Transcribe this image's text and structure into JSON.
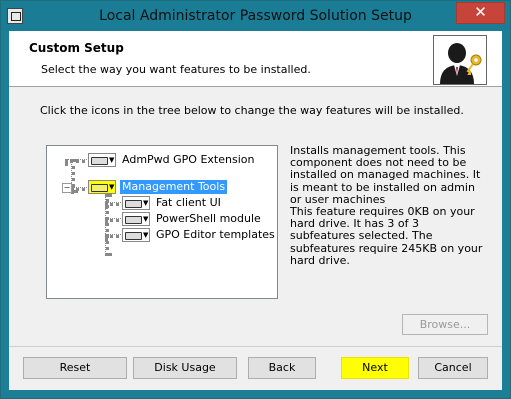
{
  "window": {
    "title": "Local Administrator Password Solution Setup",
    "close_glyph": "✕"
  },
  "header": {
    "title": "Custom Setup",
    "subtitle": "Select the way you want features to be installed."
  },
  "instruction": "Click the icons in the tree below to change the way features will be installed.",
  "tree": {
    "items": [
      {
        "label": "AdmPwd GPO Extension",
        "selected": false,
        "level": 0
      },
      {
        "label": "Management Tools",
        "selected": true,
        "level": 0,
        "expanded": true
      },
      {
        "label": "Fat client UI",
        "selected": false,
        "level": 1
      },
      {
        "label": "PowerShell module",
        "selected": false,
        "level": 1
      },
      {
        "label": "GPO Editor templates",
        "selected": false,
        "level": 1
      }
    ],
    "expander_glyph": "−",
    "arrow_glyph": "▼"
  },
  "description": {
    "text": "Installs management tools. This component does not need to be installed on managed machines. It is meant to be installed on admin or user machines\nThis feature requires 0KB on your hard drive. It has 3 of 3 subfeatures selected. The subfeatures require 245KB on your hard drive."
  },
  "buttons": {
    "browse": "Browse...",
    "reset": "Reset",
    "disk_usage": "Disk Usage",
    "back": "Back",
    "next": "Next",
    "cancel": "Cancel"
  },
  "colors": {
    "titlebar": "#1b7c95",
    "selection": "#3399ff",
    "highlight": "#ffff00"
  }
}
